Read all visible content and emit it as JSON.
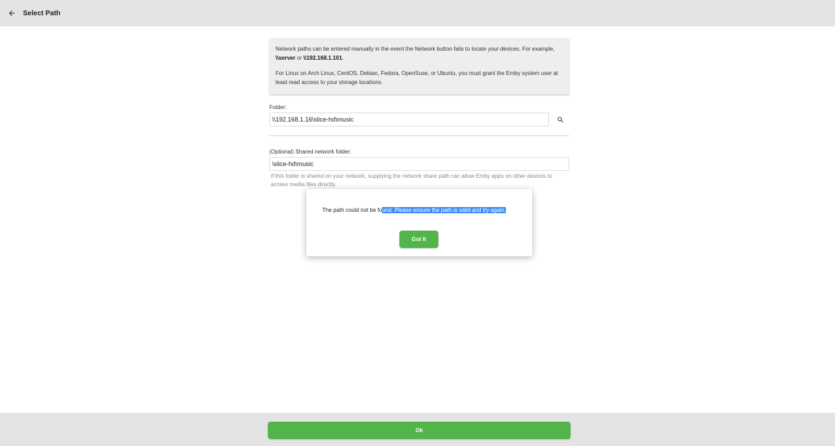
{
  "header": {
    "title": "Select Path",
    "back_icon": "arrow-left-icon"
  },
  "info": {
    "para1_pre": "Network paths can be entered manually in the event the Network button fails to locate your devices. For example, ",
    "example1": "\\\\server",
    "para1_or": " or ",
    "example2": "\\\\192.168.1.101",
    "para1_end": ".",
    "para2": "For Linux on Arch Linux, CentOS, Debian, Fedora, OpenSuse, or Ubuntu, you must grant the Emby system user at least read access to your storage locations."
  },
  "folder": {
    "label": "Folder:",
    "value": "\\\\192.168.1.16\\slice-hd\\music",
    "search_icon": "search-icon"
  },
  "share": {
    "label": "(Optional) Shared network folder:",
    "value": "\\slice-hd\\music",
    "help": "If this folder is shared on your network, supplying the network share path can allow Emby apps on other devices to access media files directly."
  },
  "dialog": {
    "message_plain": "The path could not be fo",
    "message_selected": "und. Please ensure the path is valid and try again.",
    "button": "Got It"
  },
  "footer": {
    "ok_label": "Ok"
  },
  "colors": {
    "accent_green": "#52b54b",
    "selection_blue": "#3e8ef5",
    "bar_gray": "#e4e4e4"
  }
}
